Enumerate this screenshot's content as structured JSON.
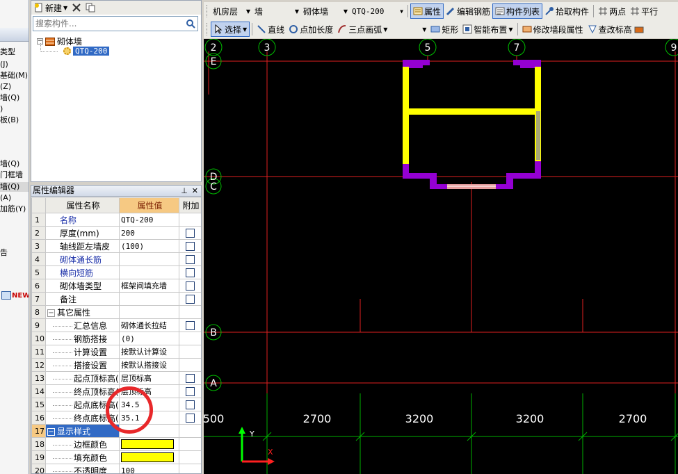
{
  "left_nav": {
    "items": [
      "类型",
      "(J)",
      "基础(M)",
      "(Z)",
      "墙(Q)",
      ")",
      "板(B)",
      "墙(Q)",
      "门框墙",
      "墙(Q)",
      "(A)",
      "加筋(Y)",
      "告"
    ],
    "new_badge": "NEW"
  },
  "component_panel": {
    "new_label": "新建",
    "search_placeholder": "搜索构件...",
    "tree": {
      "category": "砌体墙",
      "selected_item": "QTQ-200"
    }
  },
  "property_editor": {
    "title": "属性编辑器",
    "headers": {
      "name": "属性名称",
      "value": "属性值",
      "extra": "附加"
    },
    "rows": [
      {
        "num": "1",
        "name": "名称",
        "value": "QTQ-200"
      },
      {
        "num": "2",
        "name": "厚度(mm)",
        "value": "200"
      },
      {
        "num": "3",
        "name": "轴线距左墙皮",
        "value": "(100)"
      },
      {
        "num": "4",
        "name": "砌体通长筋",
        "value": ""
      },
      {
        "num": "5",
        "name": "横向短筋",
        "value": ""
      },
      {
        "num": "6",
        "name": "砌体墙类型",
        "value": "框架间填充墙"
      },
      {
        "num": "7",
        "name": "备注",
        "value": ""
      },
      {
        "num": "8",
        "name": "其它属性",
        "value": ""
      },
      {
        "num": "9",
        "name": "汇总信息",
        "value": "砌体通长拉结"
      },
      {
        "num": "10",
        "name": "钢筋搭接",
        "value": "(0)"
      },
      {
        "num": "11",
        "name": "计算设置",
        "value": "按默认计算设"
      },
      {
        "num": "12",
        "name": "搭接设置",
        "value": "按默认搭接设"
      },
      {
        "num": "13",
        "name": "起点顶标高(",
        "value": "层顶标高"
      },
      {
        "num": "14",
        "name": "终点顶标高(",
        "value": "层顶标高"
      },
      {
        "num": "15",
        "name": "起点底标高(",
        "value": "34.5"
      },
      {
        "num": "16",
        "name": "终点底标高(",
        "value": "35.1"
      },
      {
        "num": "17",
        "name": "显示样式",
        "value": ""
      },
      {
        "num": "18",
        "name": "边框颜色",
        "value": ""
      },
      {
        "num": "19",
        "name": "填充颜色",
        "value": ""
      },
      {
        "num": "20",
        "name": "不透明度",
        "value": "100"
      }
    ],
    "swatch_color": "#ffff00"
  },
  "toolbar1": {
    "floor": "机房层",
    "type": "墙",
    "subtype": "砌体墙",
    "component": "QTQ-200",
    "properties": "属性",
    "edit_rebar": "编辑钢筋",
    "component_list": "构件列表",
    "pick_component": "拾取构件",
    "two_points": "两点",
    "parallel": "平行"
  },
  "toolbar2": {
    "select": "选择",
    "line": "直线",
    "point_length": "点加长度",
    "three_point_arc": "三点画弧",
    "rectangle": "矩形",
    "smart_layout": "智能布置",
    "modify_wall_segment": "修改墙段属性",
    "check_elevation": "查改标高"
  },
  "canvas": {
    "vertical_axes": [
      "2",
      "3",
      "5",
      "7",
      "9"
    ],
    "horizontal_axes": [
      "E",
      "D",
      "C",
      "B",
      "A"
    ],
    "dimensions": [
      "500",
      "2700",
      "3200",
      "3200",
      "2700"
    ],
    "ucs_y": "Y",
    "ucs_x": "X",
    "colors": {
      "axis": "#e02020",
      "grid_bubble": "#00c000",
      "wall": "#ffff00",
      "column": "#9400d3",
      "background": "#000000"
    }
  }
}
